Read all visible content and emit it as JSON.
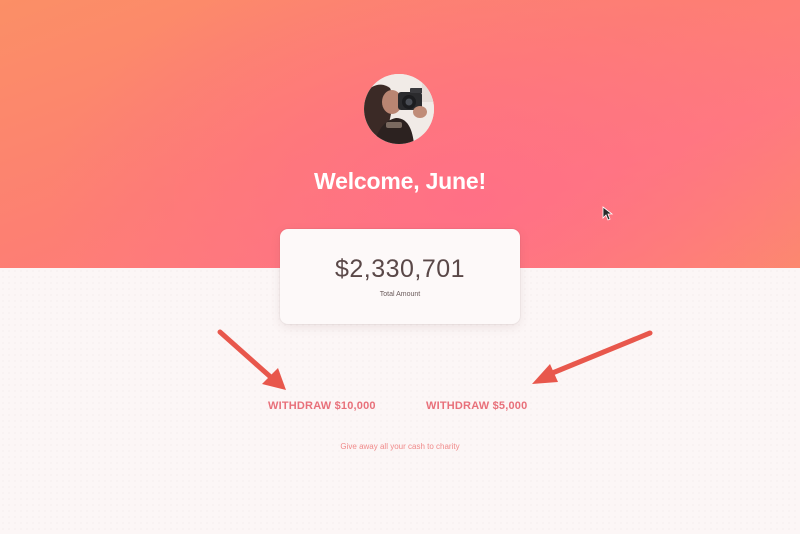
{
  "header": {
    "welcome_text": "Welcome, June!",
    "avatar_alt": "June profile photo"
  },
  "balance": {
    "amount": "$2,330,701",
    "label": "Total Amount"
  },
  "actions": {
    "withdraw_large": "WITHDRAW $10,000",
    "withdraw_small": "WITHDRAW $5,000",
    "charity_link": "Give away all your cash to charity"
  },
  "colors": {
    "hero_start": "#fb8f66",
    "hero_mid": "#ff7b7f",
    "accent": "#e8707a",
    "arrow": "#e8574c",
    "amount_text": "#5a4848"
  },
  "icons": {
    "annotation_arrows": "red-arrow-icon",
    "cursor": "mouse-pointer-icon"
  }
}
